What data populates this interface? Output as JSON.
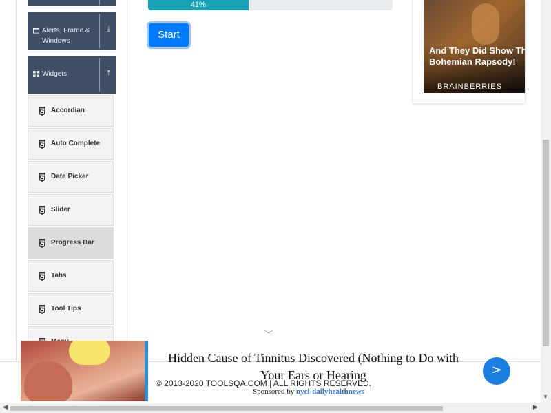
{
  "sidebar": {
    "groups": [
      {
        "label": "Alerts, Frame & Windows"
      },
      {
        "label": "Widgets"
      }
    ],
    "items": [
      {
        "label": "Accordian"
      },
      {
        "label": "Auto Complete"
      },
      {
        "label": "Date Picker"
      },
      {
        "label": "Slider"
      },
      {
        "label": "Progress Bar"
      },
      {
        "label": "Tabs"
      },
      {
        "label": "Tool Tips"
      },
      {
        "label": "Menu"
      }
    ]
  },
  "main": {
    "progress": {
      "value_percent": 41,
      "label": "41%"
    },
    "start_button": "Start"
  },
  "ad_card": {
    "title": "And They Did Show This Bohemian Rapsody!",
    "source": "BRAINBERRIES"
  },
  "footer": {
    "copyright": "© 2013-2020 TOOLSQA.COM | ALL RIGHTS RESERVED."
  },
  "banner": {
    "headline": "Hidden Cause of Tinnitus Discovered (Nothing to Do with Your Ears or Hearing",
    "sponsored_prefix": "Sponsored by",
    "sponsor": "nycl-dailyhealthnews",
    "next_label": ">"
  },
  "colors": {
    "sidebar_group": "#3f4f65",
    "progress_fill": "#17a2b8",
    "button_primary": "#007bff"
  },
  "icons": [
    "window-icon",
    "widgets-icon",
    "html5-icon",
    "chevron-down-icon",
    "chevron-up-icon"
  ]
}
